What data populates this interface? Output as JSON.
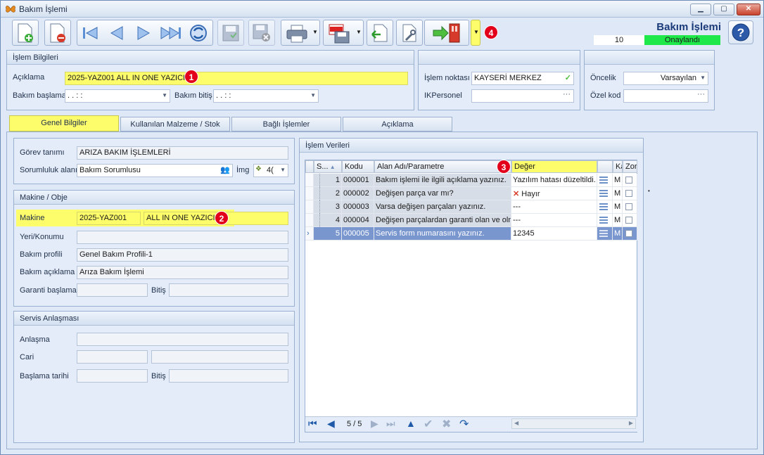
{
  "window": {
    "title": "Bakım İşlemi"
  },
  "header": {
    "title": "Bakım İşlemi",
    "record_no": "10",
    "status": "Onaylandı",
    "status_color": "#1ee84a"
  },
  "colors": {
    "highlight": "#fdfd6c",
    "badge": "#e3001b",
    "selected_row": "#7a96cf"
  },
  "badges": {
    "b1": "1",
    "b2": "2",
    "b3": "3",
    "b4": "4"
  },
  "islem": {
    "title": "İşlem Bilgileri",
    "aciklama_label": "Açıklama",
    "aciklama_value": "2025-YAZ001 ALL IN ONE YAZICI",
    "baslama_label": "Bakım başlama",
    "baslama_value": ".   .        :   :",
    "bitis_label": "Bakım bitiş",
    "bitis_value": ".   .        :   :"
  },
  "middle": {
    "nokta_label": "İşlem noktası",
    "nokta_value": "KAYSERİ MERKEZ",
    "personel_label": "IKPersonel"
  },
  "right": {
    "oncelik_label": "Öncelik",
    "oncelik_value": "Varsayılan",
    "ozel_label": "Özel kod"
  },
  "tabs": [
    "Genel Bilgiler",
    "Kullanılan Malzeme / Stok",
    "Bağlı İşlemler",
    "Açıklama"
  ],
  "genel": {
    "gorev_label": "Görev tanımı",
    "gorev_value": "ARIZA BAKIM İŞLEMLERİ",
    "sorumluluk_label": "Sorumluluk alanı",
    "sorumluluk_value": "Bakım Sorumlusu",
    "img_label": "İmg",
    "img_value": "4("
  },
  "makine": {
    "title": "Makine / Obje",
    "makine_label": "Makine",
    "makine_code": "2025-YAZ001",
    "makine_name": "ALL IN ONE YAZICI",
    "yeri_label": "Yeri/Konumu",
    "profil_label": "Bakım profili",
    "profil_value": "Genel Bakım Profili-1",
    "aciklama_label": "Bakım açıklama",
    "aciklama_value": "Arıza Bakım İşlemi",
    "garanti_label": "Garanti başlama",
    "bitis_label": "Bitiş"
  },
  "servis": {
    "title": "Servis Anlaşması",
    "anlasma_label": "Anlaşma",
    "cari_label": "Cari",
    "baslama_label": "Başlama tarihi",
    "bitis_label": "Bitiş"
  },
  "veriler": {
    "title": "İşlem Verileri",
    "columns": {
      "s": "S...",
      "kodu": "Kodu",
      "alan": "Alan Adı/Parametre",
      "deger": "Değer",
      "ka": "Ka",
      "zor": "Zor"
    },
    "rows": [
      {
        "s": "1",
        "kodu": "000001",
        "alan": "Bakım işlemi ile ilgili açıklama yazınız.",
        "deger": "Yazılım  hatası düzeltildi.",
        "m": "M"
      },
      {
        "s": "2",
        "kodu": "000002",
        "alan": "Değişen parça var mı?",
        "deger": "Hayır",
        "m": "M"
      },
      {
        "s": "3",
        "kodu": "000003",
        "alan": "Varsa değişen parçaları yazınız.",
        "deger": "---",
        "m": "M"
      },
      {
        "s": "4",
        "kodu": "000004",
        "alan": "Değişen parçalardan garanti olan ve olm",
        "deger": "---",
        "m": "M"
      },
      {
        "s": "5",
        "kodu": "000005",
        "alan": "Servis form numarasını yazınız.",
        "deger": "12345",
        "m": "M"
      }
    ],
    "pager": "5 / 5"
  }
}
